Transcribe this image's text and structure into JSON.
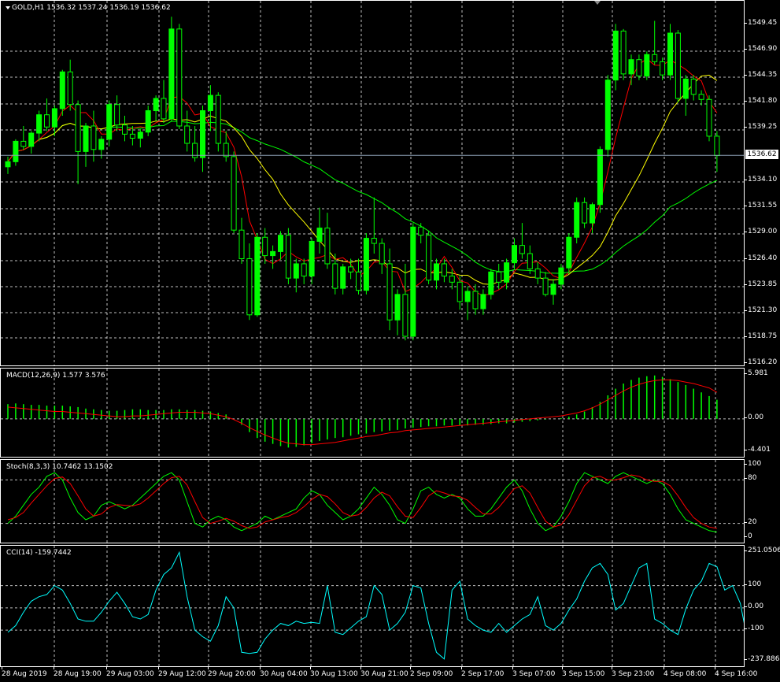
{
  "colors": {
    "background": "#000000",
    "bull_candle": "#00ff00",
    "bear_candle": "#000000",
    "ma_fast": "#ff0000",
    "ma_mid": "#ffff00",
    "ma_slow": "#00ff00",
    "macd_hist": "#00ff00",
    "macd_signal": "#ff0000",
    "stoch_main": "#00ff00",
    "stoch_signal": "#ff0000",
    "cci": "#00ffff",
    "grid": "#ffffff"
  },
  "main": {
    "title": "GOLD,H1  1536.32 1537.24 1536.19 1536.62",
    "current_price": "1536.62",
    "y_labels": [
      "1549.45",
      "1546.90",
      "1544.35",
      "1541.80",
      "1539.25",
      "1534.10",
      "1531.55",
      "1529.00",
      "1526.40",
      "1523.85",
      "1521.30",
      "1518.75",
      "1516.20"
    ]
  },
  "macd": {
    "label": "MACD(12,26,9) 1.577 3.576",
    "y_labels": [
      "5.981",
      "0.00",
      "-4.401"
    ]
  },
  "stoch": {
    "label": "Stoch(8,3,3) 10.7462 13.1502",
    "y_labels": [
      "100",
      "80",
      "20",
      "0"
    ]
  },
  "cci": {
    "label": "CCI(14) -159.7442",
    "y_labels": [
      "251.0506",
      "100",
      "0.00",
      "-100",
      "-237.8864"
    ]
  },
  "x_labels": [
    "28 Aug 2019",
    "28 Aug 19:00",
    "29 Aug 03:00",
    "29 Aug 12:00",
    "29 Aug 20:00",
    "30 Aug 04:00",
    "30 Aug 13:00",
    "30 Aug 21:00",
    "2 Sep 09:00",
    "2 Sep 17:00",
    "3 Sep 07:00",
    "3 Sep 15:00",
    "3 Sep 23:00",
    "4 Sep 08:00",
    "4 Sep 16:00"
  ],
  "chart_data": [
    {
      "type": "candlestick",
      "title": "GOLD,H1",
      "ylim": [
        1516.2,
        1549.45
      ],
      "ohlc": [
        [
          1535.5,
          1536.5,
          1534.8,
          1536.0
        ],
        [
          1536.0,
          1538.2,
          1535.6,
          1538.0
        ],
        [
          1538.0,
          1539.5,
          1537.2,
          1537.5
        ],
        [
          1537.5,
          1539.0,
          1536.8,
          1538.8
        ],
        [
          1538.8,
          1541.0,
          1538.0,
          1540.6
        ],
        [
          1540.6,
          1542.2,
          1539.0,
          1539.4
        ],
        [
          1539.4,
          1541.5,
          1538.5,
          1541.2
        ],
        [
          1541.2,
          1545.0,
          1540.5,
          1544.8
        ],
        [
          1544.8,
          1546.0,
          1541.0,
          1541.6
        ],
        [
          1541.6,
          1542.0,
          1533.8,
          1537.0
        ],
        [
          1537.0,
          1539.8,
          1535.5,
          1539.5
        ],
        [
          1539.5,
          1541.0,
          1536.0,
          1537.2
        ],
        [
          1537.2,
          1538.5,
          1536.3,
          1538.2
        ],
        [
          1538.2,
          1542.0,
          1537.5,
          1541.6
        ],
        [
          1541.6,
          1542.5,
          1539.0,
          1539.6
        ],
        [
          1539.6,
          1540.5,
          1538.0,
          1538.7
        ],
        [
          1538.7,
          1539.5,
          1537.6,
          1538.3
        ],
        [
          1538.3,
          1539.2,
          1537.4,
          1538.9
        ],
        [
          1538.9,
          1541.5,
          1538.5,
          1541.0
        ],
        [
          1541.0,
          1542.5,
          1540.0,
          1542.2
        ],
        [
          1542.2,
          1544.0,
          1539.8,
          1540.2
        ],
        [
          1540.2,
          1550.2,
          1540.0,
          1549.0
        ],
        [
          1549.0,
          1549.5,
          1539.2,
          1539.5
        ],
        [
          1539.5,
          1541.0,
          1537.0,
          1537.8
        ],
        [
          1537.8,
          1539.5,
          1536.0,
          1536.4
        ],
        [
          1536.4,
          1541.5,
          1535.0,
          1541.0
        ],
        [
          1541.0,
          1543.5,
          1539.0,
          1542.5
        ],
        [
          1542.5,
          1542.8,
          1537.0,
          1537.8
        ],
        [
          1537.8,
          1539.0,
          1536.0,
          1536.5
        ],
        [
          1536.5,
          1537.0,
          1529.0,
          1529.3
        ],
        [
          1529.3,
          1530.5,
          1526.0,
          1526.5
        ],
        [
          1526.5,
          1528.0,
          1520.5,
          1521.0
        ],
        [
          1521.0,
          1529.0,
          1520.8,
          1528.6
        ],
        [
          1528.6,
          1529.5,
          1526.0,
          1526.8
        ],
        [
          1526.8,
          1527.8,
          1525.5,
          1527.2
        ],
        [
          1527.2,
          1529.2,
          1526.4,
          1528.8
        ],
        [
          1528.8,
          1529.5,
          1524.0,
          1524.6
        ],
        [
          1524.6,
          1526.5,
          1523.2,
          1526.0
        ],
        [
          1526.0,
          1526.5,
          1524.0,
          1524.8
        ],
        [
          1524.8,
          1528.5,
          1524.0,
          1528.2
        ],
        [
          1528.2,
          1531.5,
          1527.0,
          1529.5
        ],
        [
          1529.5,
          1531.0,
          1525.5,
          1526.0
        ],
        [
          1526.0,
          1527.0,
          1523.0,
          1523.6
        ],
        [
          1523.6,
          1526.0,
          1523.0,
          1525.7
        ],
        [
          1525.7,
          1526.5,
          1524.5,
          1525.2
        ],
        [
          1525.2,
          1526.5,
          1523.0,
          1523.4
        ],
        [
          1523.4,
          1529.0,
          1523.0,
          1528.5
        ],
        [
          1528.5,
          1532.5,
          1527.0,
          1528.0
        ],
        [
          1528.0,
          1528.5,
          1525.0,
          1526.0
        ],
        [
          1526.0,
          1527.5,
          1519.5,
          1520.5
        ],
        [
          1520.5,
          1523.5,
          1519.0,
          1523.0
        ],
        [
          1523.0,
          1526.0,
          1518.5,
          1518.9
        ],
        [
          1518.9,
          1530.0,
          1518.5,
          1529.6
        ],
        [
          1529.6,
          1530.0,
          1528.0,
          1528.8
        ],
        [
          1528.8,
          1529.2,
          1524.0,
          1524.4
        ],
        [
          1524.4,
          1526.5,
          1523.5,
          1526.0
        ],
        [
          1526.0,
          1526.5,
          1524.2,
          1524.8
        ],
        [
          1524.8,
          1525.5,
          1523.5,
          1524.2
        ],
        [
          1524.2,
          1524.8,
          1521.5,
          1522.3
        ],
        [
          1522.3,
          1523.8,
          1520.5,
          1523.3
        ],
        [
          1523.3,
          1524.0,
          1521.0,
          1521.6
        ],
        [
          1521.6,
          1523.5,
          1521.0,
          1523.0
        ],
        [
          1523.0,
          1525.5,
          1522.5,
          1525.2
        ],
        [
          1525.2,
          1526.0,
          1523.5,
          1524.2
        ],
        [
          1524.2,
          1526.5,
          1523.5,
          1526.1
        ],
        [
          1526.1,
          1528.5,
          1525.5,
          1527.8
        ],
        [
          1527.8,
          1530.0,
          1526.5,
          1527.0
        ],
        [
          1527.0,
          1527.8,
          1525.0,
          1525.5
        ],
        [
          1525.5,
          1526.2,
          1524.0,
          1524.6
        ],
        [
          1524.6,
          1525.2,
          1522.8,
          1523.0
        ],
        [
          1523.0,
          1524.5,
          1522.0,
          1524.0
        ],
        [
          1524.0,
          1526.0,
          1523.5,
          1525.6
        ],
        [
          1525.6,
          1529.0,
          1525.0,
          1528.6
        ],
        [
          1528.6,
          1532.5,
          1528.0,
          1532.0
        ],
        [
          1532.0,
          1532.5,
          1529.5,
          1530.0
        ],
        [
          1530.0,
          1532.0,
          1529.0,
          1531.8
        ],
        [
          1531.8,
          1537.5,
          1531.0,
          1537.2
        ],
        [
          1537.2,
          1544.5,
          1536.5,
          1544.0
        ],
        [
          1544.0,
          1549.5,
          1543.0,
          1548.8
        ],
        [
          1548.8,
          1549.0,
          1544.0,
          1544.6
        ],
        [
          1544.6,
          1546.5,
          1543.5,
          1546.0
        ],
        [
          1546.0,
          1546.5,
          1544.0,
          1544.4
        ],
        [
          1544.4,
          1546.8,
          1544.0,
          1546.5
        ],
        [
          1546.5,
          1549.8,
          1545.5,
          1545.8
        ],
        [
          1545.8,
          1546.2,
          1544.0,
          1544.5
        ],
        [
          1544.5,
          1549.5,
          1544.0,
          1548.6
        ],
        [
          1548.6,
          1548.9,
          1541.8,
          1542.2
        ],
        [
          1542.2,
          1544.5,
          1540.5,
          1544.1
        ],
        [
          1544.1,
          1544.5,
          1542.0,
          1542.6
        ],
        [
          1542.6,
          1543.0,
          1541.5,
          1542.1
        ],
        [
          1542.1,
          1542.5,
          1538.0,
          1538.5
        ],
        [
          1538.5,
          1539.0,
          1535.0,
          1536.6
        ]
      ]
    },
    {
      "type": "bar",
      "title": "MACD(12,26,9)",
      "ylim": [
        -4.401,
        5.981
      ],
      "series": [
        {
          "values": [
            2.0,
            2.1,
            2.0,
            1.9,
            1.9,
            1.8,
            1.8,
            1.8,
            1.7,
            1.6,
            1.4,
            1.3,
            1.2,
            1.1,
            1.1,
            1.2,
            1.3,
            1.3,
            1.2,
            1.2,
            1.2,
            1.3,
            1.3,
            1.2,
            1.2,
            1.1,
            1.0,
            0.8,
            0.6,
            0.0,
            -0.8,
            -1.8,
            -2.6,
            -3.1,
            -3.4,
            -3.7,
            -3.9,
            -3.8,
            -3.6,
            -3.3,
            -3.0,
            -2.8,
            -2.6,
            -2.5,
            -2.3,
            -2.1,
            -2.0,
            -1.8,
            -1.7,
            -1.6,
            -1.5,
            -1.3,
            -1.2,
            -1.1,
            -1.0,
            -1.0,
            -0.9,
            -0.9,
            -0.9,
            -0.9,
            -0.8,
            -0.8,
            -0.7,
            -0.6,
            -0.6,
            -0.5,
            -0.4,
            -0.3,
            -0.2,
            -0.1,
            0.0,
            0.1,
            0.3,
            0.6,
            1.0,
            1.6,
            2.3,
            3.2,
            4.1,
            4.8,
            5.3,
            5.6,
            5.8,
            5.9,
            5.7,
            5.4,
            5.0,
            4.6,
            4.1,
            3.6,
            3.1,
            2.6
          ]
        },
        {
          "values": [
            1.6,
            1.5,
            1.4,
            1.3,
            1.2,
            1.1,
            1.0,
            1.0,
            0.9,
            0.8,
            0.7,
            0.6,
            0.5,
            0.4,
            0.3,
            0.3,
            0.4,
            0.4,
            0.5,
            0.6,
            0.7,
            0.8,
            0.9,
            0.9,
            0.9,
            0.8,
            0.7,
            0.5,
            0.3,
            -0.1,
            -0.6,
            -1.2,
            -1.7,
            -2.2,
            -2.6,
            -3.0,
            -3.3,
            -3.4,
            -3.5,
            -3.5,
            -3.4,
            -3.3,
            -3.2,
            -3.0,
            -2.8,
            -2.6,
            -2.4,
            -2.3,
            -2.1,
            -1.9,
            -1.8,
            -1.6,
            -1.5,
            -1.4,
            -1.3,
            -1.2,
            -1.1,
            -1.0,
            -0.9,
            -0.8,
            -0.7,
            -0.6,
            -0.5,
            -0.4,
            -0.3,
            -0.2,
            -0.1,
            0.0,
            0.1,
            0.2,
            0.3,
            0.4,
            0.6,
            0.8,
            1.1,
            1.5,
            2.0,
            2.6,
            3.2,
            3.8,
            4.3,
            4.7,
            5.0,
            5.2,
            5.3,
            5.3,
            5.2,
            5.0,
            4.8,
            4.5,
            4.2,
            3.6
          ]
        }
      ]
    },
    {
      "type": "line",
      "title": "Stoch(8,3,3)",
      "ylim": [
        0,
        100
      ],
      "series": [
        {
          "values": [
            20,
            30,
            45,
            60,
            70,
            85,
            90,
            80,
            55,
            35,
            25,
            30,
            45,
            50,
            45,
            40,
            45,
            55,
            65,
            75,
            85,
            90,
            80,
            50,
            20,
            15,
            25,
            30,
            25,
            15,
            10,
            15,
            20,
            30,
            25,
            30,
            35,
            40,
            55,
            65,
            60,
            45,
            35,
            25,
            30,
            40,
            55,
            70,
            60,
            45,
            25,
            20,
            40,
            65,
            70,
            60,
            55,
            60,
            55,
            40,
            30,
            30,
            40,
            55,
            70,
            80,
            65,
            40,
            20,
            10,
            15,
            30,
            50,
            75,
            90,
            85,
            80,
            75,
            85,
            90,
            85,
            80,
            75,
            80,
            75,
            60,
            40,
            25,
            20,
            15,
            10,
            8
          ]
        },
        {
          "values": [
            25,
            28,
            35,
            48,
            60,
            72,
            82,
            84,
            75,
            58,
            40,
            30,
            33,
            42,
            46,
            45,
            44,
            47,
            55,
            65,
            75,
            83,
            85,
            73,
            50,
            28,
            20,
            23,
            27,
            23,
            17,
            13,
            15,
            22,
            25,
            28,
            30,
            35,
            43,
            53,
            60,
            57,
            47,
            35,
            30,
            32,
            42,
            55,
            63,
            58,
            43,
            30,
            28,
            42,
            58,
            65,
            62,
            58,
            57,
            52,
            42,
            33,
            33,
            42,
            55,
            68,
            72,
            62,
            42,
            23,
            15,
            18,
            32,
            52,
            72,
            83,
            85,
            80,
            80,
            83,
            87,
            85,
            80,
            78,
            78,
            72,
            58,
            42,
            28,
            20,
            15,
            13
          ]
        }
      ]
    },
    {
      "type": "line",
      "title": "CCI(14)",
      "ylim": [
        -237.8864,
        251.0506
      ],
      "series": [
        {
          "values": [
            -110,
            -80,
            -20,
            30,
            50,
            60,
            100,
            80,
            20,
            -50,
            -60,
            -60,
            -20,
            30,
            70,
            20,
            -40,
            -50,
            -30,
            80,
            150,
            180,
            250,
            50,
            -100,
            -130,
            -150,
            -80,
            50,
            0,
            -200,
            -205,
            -200,
            -140,
            -100,
            -70,
            -80,
            -60,
            -70,
            -65,
            -70,
            100,
            -110,
            -120,
            -90,
            -60,
            -40,
            100,
            60,
            -100,
            -70,
            -20,
            100,
            90,
            -70,
            -200,
            -230,
            80,
            120,
            -50,
            -80,
            -100,
            -110,
            -70,
            -110,
            -80,
            -50,
            -30,
            50,
            -80,
            -100,
            -70,
            -10,
            40,
            120,
            180,
            200,
            150,
            -10,
            20,
            100,
            180,
            200,
            -50,
            -70,
            -100,
            -120,
            -5,
            80,
            120,
            200,
            185,
            80,
            100,
            20,
            -160
          ]
        }
      ]
    }
  ]
}
